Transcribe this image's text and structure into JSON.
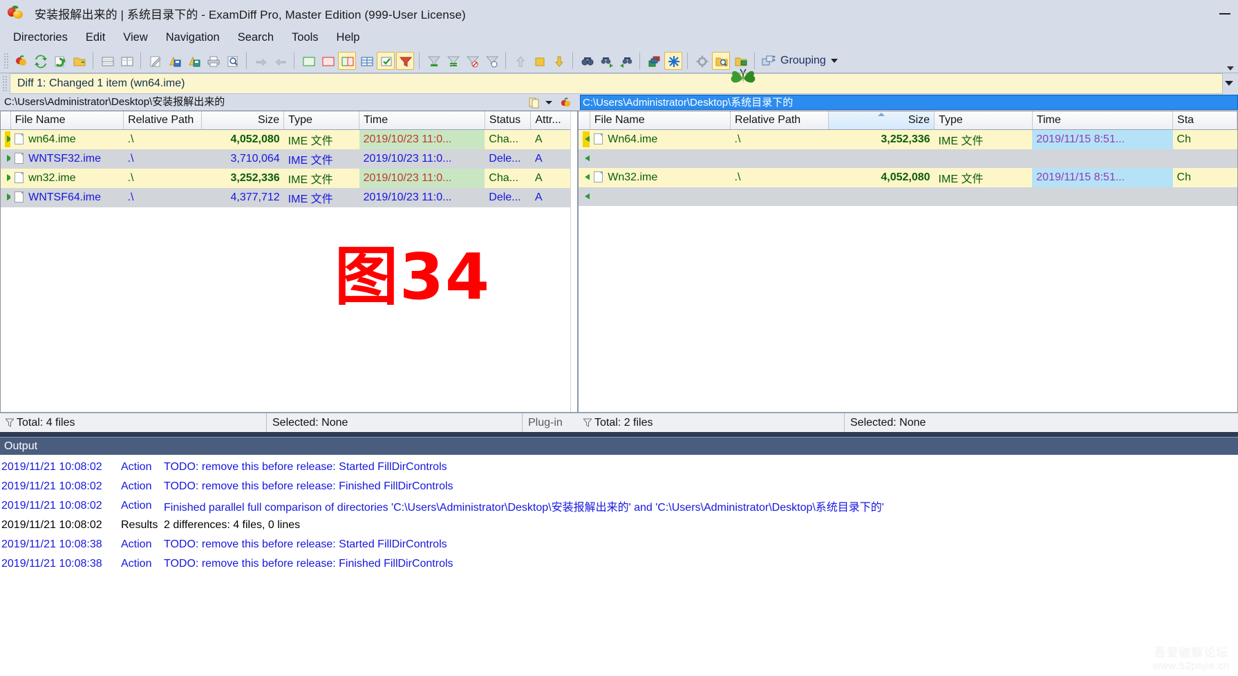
{
  "window": {
    "title": "安装报解出来的  |  系统目录下的 - ExamDiff Pro, Master Edition (999-User License)",
    "minimize_label": "—",
    "app_icon": "apple-lemon-icon"
  },
  "menu": {
    "items": [
      {
        "label": "Directories",
        "name": "menu-directories"
      },
      {
        "label": "Edit",
        "name": "menu-edit"
      },
      {
        "label": "View",
        "name": "menu-view"
      },
      {
        "label": "Navigation",
        "name": "menu-navigation"
      },
      {
        "label": "Search",
        "name": "menu-search"
      },
      {
        "label": "Tools",
        "name": "menu-tools"
      },
      {
        "label": "Help",
        "name": "menu-help"
      }
    ]
  },
  "toolbar": {
    "grouping_label": "Grouping",
    "buttons": [
      "new-comparison-icon",
      "recompare-icon",
      "refresh-icon",
      "open-folder-icon",
      "view-horizontal-icon",
      "view-vertical-icon",
      "edit-icon",
      "save-left-icon",
      "save-right-icon",
      "print-icon",
      "print-preview-icon",
      "copy-right-icon",
      "copy-left-icon",
      "show-added-icon",
      "show-deleted-icon",
      "show-changed-icon",
      "show-identical-icon",
      "show-checked-icon",
      "filter-icon",
      "filter-added-icon",
      "filter-identical-icon",
      "filter-deleted-icon",
      "filter-changed-icon",
      "move-up-icon",
      "stop-icon",
      "move-down-icon",
      "find-icon",
      "find-next-icon",
      "find-prev-icon",
      "plugins-icon",
      "snowflake-icon",
      "options-icon",
      "inspect-folder-icon",
      "sync-folder-icon"
    ]
  },
  "diffbar": {
    "text": "Diff 1: Changed 1 item (wn64.ime)"
  },
  "left_pane": {
    "path": "C:\\Users\\Administrator\\Desktop\\安装报解出来的",
    "path_selected": false,
    "columns": [
      "File Name",
      "Relative Path",
      "Size",
      "Type",
      "Time",
      "Status",
      "Attr..."
    ],
    "sorted_column": null,
    "rows": [
      {
        "marker": "hl",
        "name": "wn64.ime",
        "rel": ".\\",
        "size": "4,052,080",
        "type": "IME 文件",
        "time": "2019/10/23 11:0...",
        "status": "Cha...",
        "attr": "A",
        "style": "r-change"
      },
      {
        "marker": "plain",
        "name": "WNTSF32.ime",
        "rel": ".\\",
        "size": "3,710,064",
        "type": "IME 文件",
        "time": "2019/10/23 11:0...",
        "status": "Dele...",
        "attr": "A",
        "style": "r-del"
      },
      {
        "marker": "plain",
        "name": "wn32.ime",
        "rel": ".\\",
        "size": "3,252,336",
        "type": "IME 文件",
        "time": "2019/10/23 11:0...",
        "status": "Cha...",
        "attr": "A",
        "style": "r-change"
      },
      {
        "marker": "plain",
        "name": "WNTSF64.ime",
        "rel": ".\\",
        "size": "4,377,712",
        "type": "IME 文件",
        "time": "2019/10/23 11:0...",
        "status": "Dele...",
        "attr": "A",
        "style": "r-del"
      }
    ],
    "status": {
      "total": "Total: 4 files",
      "selected": "Selected: None",
      "plugin": "Plug-in"
    }
  },
  "right_pane": {
    "path": "C:\\Users\\Administrator\\Desktop\\系统目录下的",
    "path_selected": true,
    "columns": [
      "File Name",
      "Relative Path",
      "Size",
      "Type",
      "Time",
      "Sta"
    ],
    "sorted_column": "Size",
    "rows": [
      {
        "marker": "hl",
        "name": "Wn64.ime",
        "rel": ".\\",
        "size": "3,252,336",
        "type": "IME 文件",
        "time": "2019/11/15 8:51...",
        "status": "Ch",
        "style": "r-rchange"
      },
      {
        "marker": "plain",
        "name": "",
        "rel": "",
        "size": "",
        "type": "",
        "time": "",
        "status": "",
        "style": "r-blank"
      },
      {
        "marker": "plain",
        "name": "Wn32.ime",
        "rel": ".\\",
        "size": "4,052,080",
        "type": "IME 文件",
        "time": "2019/11/15 8:51...",
        "status": "Ch",
        "style": "r-rchange"
      },
      {
        "marker": "plain",
        "name": "",
        "rel": "",
        "size": "",
        "type": "",
        "time": "",
        "status": "",
        "style": "r-blank"
      }
    ],
    "status": {
      "total": "Total: 2 files",
      "selected": "Selected: None"
    }
  },
  "output": {
    "title": "Output",
    "rows": [
      {
        "ts": "2019/11/21 10:08:02",
        "kind": "Action",
        "msg": "TODO: remove this before release: Started FillDirControls",
        "color": "lg-blue"
      },
      {
        "ts": "2019/11/21 10:08:02",
        "kind": "Action",
        "msg": "TODO: remove this before release: Finished FillDirControls",
        "color": "lg-blue"
      },
      {
        "ts": "2019/11/21 10:08:02",
        "kind": "Action",
        "msg": "Finished parallel full comparison of directories 'C:\\Users\\Administrator\\Desktop\\安装报解出来的' and 'C:\\Users\\Administrator\\Desktop\\系统目录下的'",
        "color": "lg-blue"
      },
      {
        "ts": "2019/11/21 10:08:02",
        "kind": "Results",
        "msg": "2 differences: 4 files, 0 lines",
        "color": "lg-black"
      },
      {
        "ts": "2019/11/21 10:08:38",
        "kind": "Action",
        "msg": "TODO: remove this before release: Started FillDirControls",
        "color": "lg-blue"
      },
      {
        "ts": "2019/11/21 10:08:38",
        "kind": "Action",
        "msg": "TODO: remove this before release: Finished FillDirControls",
        "color": "lg-blue"
      }
    ]
  },
  "overlay": {
    "stamp": "图34",
    "watermark_line1": "吾爱破解论坛",
    "watermark_line2": "www.52pojie.cn"
  },
  "colors": {
    "chrome": "#d6dce8",
    "changed_bg": "#fdf6c9",
    "deleted_bg": "#d2d5da",
    "time_left_bg": "#c9e6c3",
    "time_right_bg": "#b6e2f7",
    "selection_blue": "#2b8cf0",
    "output_header": "#4a5d7e",
    "stamp_red": "#ff0000"
  }
}
